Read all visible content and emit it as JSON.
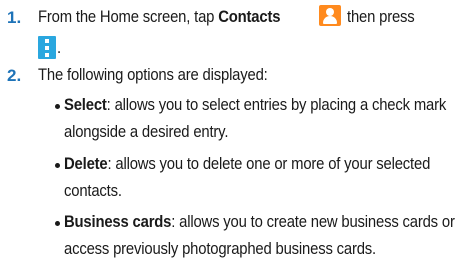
{
  "steps": [
    {
      "number": "1.",
      "text_before": "From the Home screen, tap ",
      "bold": "Contacts",
      "text_after": " then press",
      "line2": "."
    },
    {
      "number": "2.",
      "text": "The following options are displayed:"
    }
  ],
  "options": [
    {
      "term": "Select",
      "line1": ": allows you to select entries by placing a check mark",
      "line2": "alongside a desired entry."
    },
    {
      "term": "Delete",
      "line1": ": allows you to delete one or more of your selected",
      "line2": "contacts."
    },
    {
      "term": "Business cards",
      "line1": ": allows you to create new business cards or",
      "line2": "access previously photographed business cards."
    }
  ],
  "icons": {
    "contacts": "contacts-person-icon",
    "menu": "menu-more-icon",
    "contacts_color": "#ff8a1e",
    "menu_color": "#2aa7df",
    "step_number_color": "#1e73b8"
  }
}
